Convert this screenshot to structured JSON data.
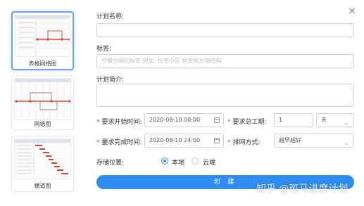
{
  "templates": [
    {
      "label": "表格网络图",
      "selected": true
    },
    {
      "label": "网络图",
      "selected": false
    },
    {
      "label": "横道图",
      "selected": false
    }
  ],
  "form": {
    "plan_name": {
      "label": "计划名称:",
      "value": ""
    },
    "tags": {
      "label": "标签:",
      "placeholder": "空格分隔的标签,例如: 住宅小区 框架剪力墙结构"
    },
    "summary": {
      "label": "计划简介:",
      "value": ""
    },
    "start_time": {
      "label": "要求开始时间:",
      "value": "2020-08-10 00:00"
    },
    "duration": {
      "label": "要求总工期:",
      "value": "1",
      "unit": "天"
    },
    "end_time": {
      "label": "要求完成时间:",
      "value": "2020-08-10 24:00"
    },
    "schedule_mode": {
      "label": "排网方式:",
      "value": "越早越好"
    },
    "storage": {
      "label": "存储位置:",
      "options": [
        "本地",
        "云端"
      ],
      "selected": "本地"
    }
  },
  "create_button": "创 建",
  "watermark": "知乎 @斑马进度计划",
  "colors": {
    "accent": "#2f8cf0",
    "required": "#e0393e",
    "selected_border": "#6aa5ef"
  }
}
